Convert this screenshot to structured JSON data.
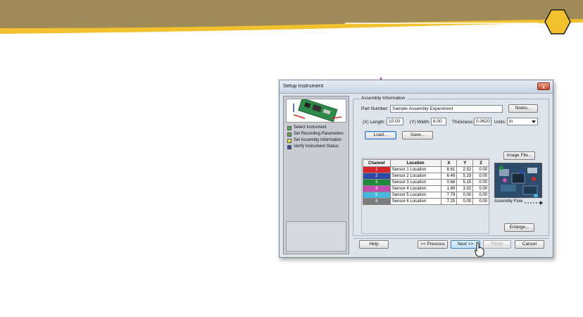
{
  "banner": {
    "bg_color": "#a08a57",
    "accent_color": "#f2c12e"
  },
  "window": {
    "title": "Setup Instrument",
    "close_glyph": "x"
  },
  "steps": [
    {
      "label": "Select Instrument",
      "color": "#5aa64a"
    },
    {
      "label": "Set Recording Parameters",
      "color": "#5aa64a"
    },
    {
      "label": "Set Assembly Information",
      "color": "#e8e23a"
    },
    {
      "label": "Verify Instrument Status",
      "color": "#3a4a9a"
    }
  ],
  "assembly": {
    "group_label": "Assembly Information",
    "part_number_label": "Part Number:",
    "part_number_value": "Sample Assembly Experiment",
    "notes_button": "Notes...",
    "length_label": "(X) Length:",
    "length_value": "10.00",
    "width_label": "(Y) Width:",
    "width_value": "8.00",
    "thickness_label": "Thickness:",
    "thickness_value": "0.0620",
    "units_label": "Units:",
    "units_value": "in",
    "load_button": "Load...",
    "save_button": "Save...",
    "image_file_button": "Image File...",
    "assembly_flow_label": "Assembly Flow",
    "enlarge_button": "Enlarge..."
  },
  "table": {
    "headers": [
      "Channel",
      "Location",
      "X",
      "Y",
      "Z"
    ],
    "rows": [
      {
        "channel": "1",
        "color": "#d8262d",
        "location": "Sensor 1 Location",
        "x": "8.61",
        "y": "2.52",
        "z": "0.00"
      },
      {
        "channel": "2",
        "color": "#2f4aa5",
        "location": "Sensor 2 Location",
        "x": "6.49",
        "y": "5.19",
        "z": "0.00"
      },
      {
        "channel": "3",
        "color": "#1f8a3a",
        "location": "Sensor 3 Location",
        "x": "0.68",
        "y": "5.15",
        "z": "0.00"
      },
      {
        "channel": "4",
        "color": "#c24eb1",
        "location": "Sensor 4 Location",
        "x": "1.89",
        "y": "3.32",
        "z": "0.00"
      },
      {
        "channel": "5",
        "color": "#47b7e0",
        "location": "Sensor 5 Location",
        "x": "7.79",
        "y": "0.00",
        "z": "0.00"
      },
      {
        "channel": "6",
        "color": "#7c7c7c",
        "location": "Sensor 6 Location",
        "x": "7.25",
        "y": "0.00",
        "z": "0.00"
      }
    ]
  },
  "footer": {
    "help": "Help",
    "previous": "<< Previous",
    "next": "Next >>",
    "finish": "Finish",
    "cancel": "Cancel"
  }
}
